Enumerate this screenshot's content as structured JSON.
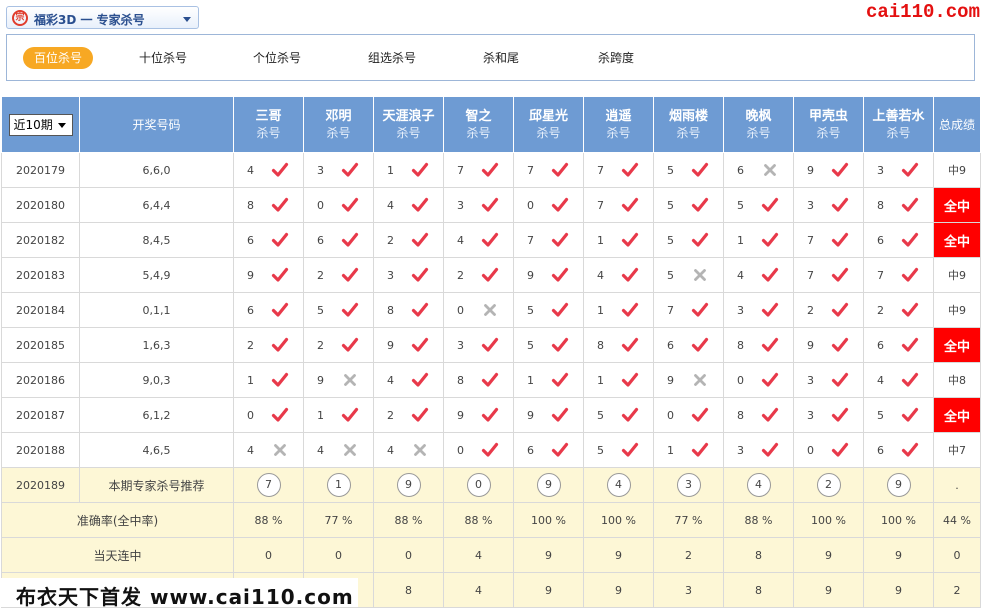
{
  "selector": {
    "logo_glyph": "宗",
    "label": "福彩3D 一 专家杀号"
  },
  "site_logo": "cai110.com",
  "tabs": [
    {
      "label": "百位杀号",
      "active": true
    },
    {
      "label": "十位杀号"
    },
    {
      "label": "个位杀号"
    },
    {
      "label": "组选杀号"
    },
    {
      "label": "杀和尾"
    },
    {
      "label": "杀跨度"
    }
  ],
  "table": {
    "period_select": "近10期",
    "header_draw": "开奖号码",
    "header_total": "总成绩",
    "sub_label": "杀号",
    "experts": [
      "三哥",
      "邓明",
      "天涯浪子",
      "智之",
      "邱星光",
      "逍遥",
      "烟雨楼",
      "晚枫",
      "甲壳虫",
      "上善若水"
    ],
    "rows": [
      {
        "issue": "2020179",
        "draw": "6,6,0",
        "picks": [
          [
            "4",
            "ok"
          ],
          [
            "3",
            "ok"
          ],
          [
            "1",
            "ok"
          ],
          [
            "7",
            "ok"
          ],
          [
            "7",
            "ok"
          ],
          [
            "7",
            "ok"
          ],
          [
            "5",
            "ok"
          ],
          [
            "6",
            "no"
          ],
          [
            "9",
            "ok"
          ],
          [
            "3",
            "ok"
          ]
        ],
        "total": "中9",
        "full": false
      },
      {
        "issue": "2020180",
        "draw": "6,4,4",
        "picks": [
          [
            "8",
            "ok"
          ],
          [
            "0",
            "ok"
          ],
          [
            "4",
            "ok"
          ],
          [
            "3",
            "ok"
          ],
          [
            "0",
            "ok"
          ],
          [
            "7",
            "ok"
          ],
          [
            "5",
            "ok"
          ],
          [
            "5",
            "ok"
          ],
          [
            "3",
            "ok"
          ],
          [
            "8",
            "ok"
          ]
        ],
        "total": "全中",
        "full": true
      },
      {
        "issue": "2020182",
        "draw": "8,4,5",
        "picks": [
          [
            "6",
            "ok"
          ],
          [
            "6",
            "ok"
          ],
          [
            "2",
            "ok"
          ],
          [
            "4",
            "ok"
          ],
          [
            "7",
            "ok"
          ],
          [
            "1",
            "ok"
          ],
          [
            "5",
            "ok"
          ],
          [
            "1",
            "ok"
          ],
          [
            "7",
            "ok"
          ],
          [
            "6",
            "ok"
          ]
        ],
        "total": "全中",
        "full": true
      },
      {
        "issue": "2020183",
        "draw": "5,4,9",
        "picks": [
          [
            "9",
            "ok"
          ],
          [
            "2",
            "ok"
          ],
          [
            "3",
            "ok"
          ],
          [
            "2",
            "ok"
          ],
          [
            "9",
            "ok"
          ],
          [
            "4",
            "ok"
          ],
          [
            "5",
            "no"
          ],
          [
            "4",
            "ok"
          ],
          [
            "7",
            "ok"
          ],
          [
            "7",
            "ok"
          ]
        ],
        "total": "中9",
        "full": false
      },
      {
        "issue": "2020184",
        "draw": "0,1,1",
        "picks": [
          [
            "6",
            "ok"
          ],
          [
            "5",
            "ok"
          ],
          [
            "8",
            "ok"
          ],
          [
            "0",
            "no"
          ],
          [
            "5",
            "ok"
          ],
          [
            "1",
            "ok"
          ],
          [
            "7",
            "ok"
          ],
          [
            "3",
            "ok"
          ],
          [
            "2",
            "ok"
          ],
          [
            "2",
            "ok"
          ]
        ],
        "total": "中9",
        "full": false
      },
      {
        "issue": "2020185",
        "draw": "1,6,3",
        "picks": [
          [
            "2",
            "ok"
          ],
          [
            "2",
            "ok"
          ],
          [
            "9",
            "ok"
          ],
          [
            "3",
            "ok"
          ],
          [
            "5",
            "ok"
          ],
          [
            "8",
            "ok"
          ],
          [
            "6",
            "ok"
          ],
          [
            "8",
            "ok"
          ],
          [
            "9",
            "ok"
          ],
          [
            "6",
            "ok"
          ]
        ],
        "total": "全中",
        "full": true
      },
      {
        "issue": "2020186",
        "draw": "9,0,3",
        "picks": [
          [
            "1",
            "ok"
          ],
          [
            "9",
            "no"
          ],
          [
            "4",
            "ok"
          ],
          [
            "8",
            "ok"
          ],
          [
            "1",
            "ok"
          ],
          [
            "1",
            "ok"
          ],
          [
            "9",
            "no"
          ],
          [
            "0",
            "ok"
          ],
          [
            "3",
            "ok"
          ],
          [
            "4",
            "ok"
          ]
        ],
        "total": "中8",
        "full": false
      },
      {
        "issue": "2020187",
        "draw": "6,1,2",
        "picks": [
          [
            "0",
            "ok"
          ],
          [
            "1",
            "ok"
          ],
          [
            "2",
            "ok"
          ],
          [
            "9",
            "ok"
          ],
          [
            "9",
            "ok"
          ],
          [
            "5",
            "ok"
          ],
          [
            "0",
            "ok"
          ],
          [
            "8",
            "ok"
          ],
          [
            "3",
            "ok"
          ],
          [
            "5",
            "ok"
          ]
        ],
        "total": "全中",
        "full": true
      },
      {
        "issue": "2020188",
        "draw": "4,6,5",
        "picks": [
          [
            "4",
            "no"
          ],
          [
            "4",
            "no"
          ],
          [
            "4",
            "no"
          ],
          [
            "0",
            "ok"
          ],
          [
            "6",
            "ok"
          ],
          [
            "5",
            "ok"
          ],
          [
            "1",
            "ok"
          ],
          [
            "3",
            "ok"
          ],
          [
            "0",
            "ok"
          ],
          [
            "6",
            "ok"
          ]
        ],
        "total": "中7",
        "full": false
      }
    ],
    "recommend": {
      "issue": "2020189",
      "label": "本期专家杀号推荐",
      "balls": [
        "7",
        "1",
        "9",
        "0",
        "9",
        "4",
        "3",
        "4",
        "2",
        "9"
      ],
      "total": "."
    },
    "accuracy": {
      "label": "准确率(全中率)",
      "values": [
        "88 %",
        "77 %",
        "88 %",
        "88 %",
        "100 %",
        "100 %",
        "77 %",
        "88 %",
        "100 %",
        "100 %"
      ],
      "total": "44 %"
    },
    "streak": {
      "label": "当天连中",
      "values": [
        "0",
        "0",
        "0",
        "4",
        "9",
        "9",
        "2",
        "8",
        "9",
        "9"
      ],
      "total": "0"
    },
    "last_row": {
      "values": [
        "",
        "",
        "8",
        "4",
        "9",
        "9",
        "3",
        "8",
        "9",
        "9"
      ],
      "total": "2"
    }
  },
  "footer_banner": "布衣天下首发 www.cai110.com",
  "colors": {
    "header_blue": "#6e9bd3",
    "check_red": "#e8394a",
    "cross_gray": "#b4b4b4",
    "full_red": "#ff0000",
    "tab_orange": "#f7a823"
  }
}
